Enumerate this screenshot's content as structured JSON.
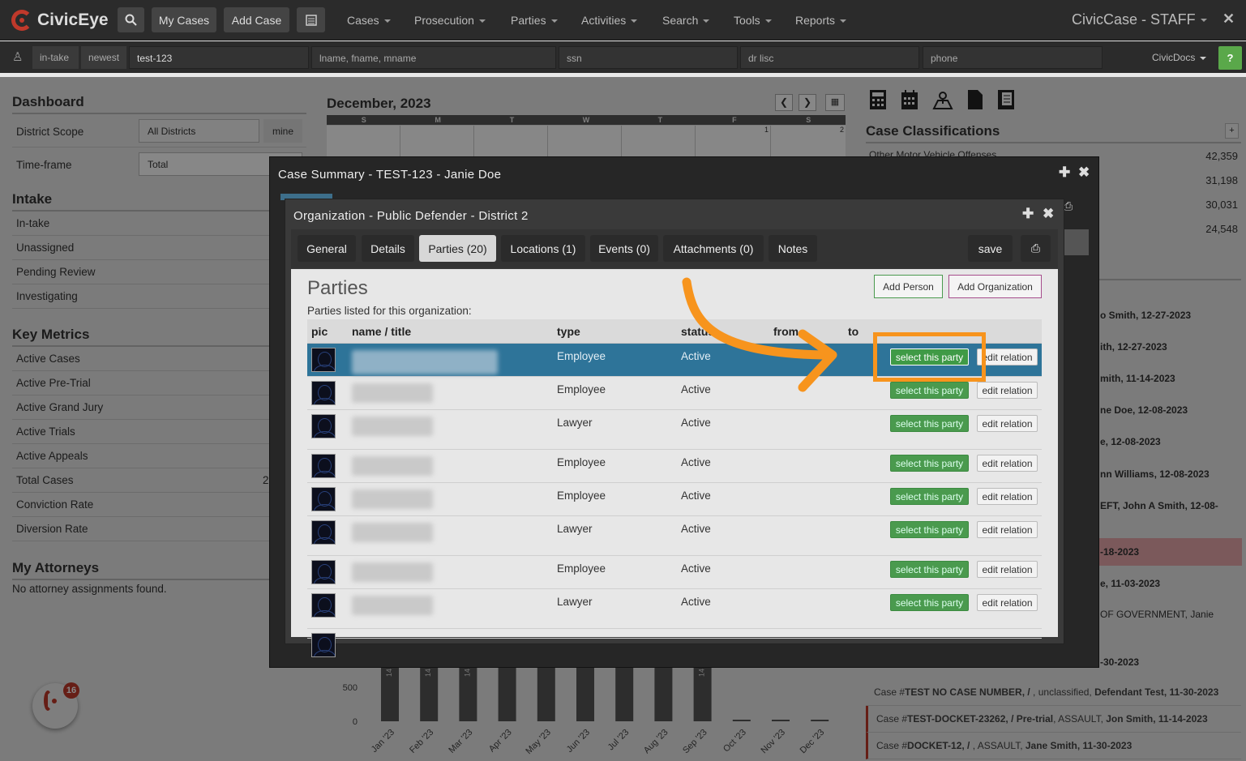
{
  "brand": "CivicEye",
  "topnav": {
    "my_cases": "My Cases",
    "add_case": "Add Case",
    "menus": [
      "Cases",
      "Prosecution",
      "Parties",
      "Activities",
      "Search",
      "Tools",
      "Reports"
    ],
    "app_title": "CivicCase - STAFF"
  },
  "searchbar": {
    "intake": "in-take",
    "newest": "newest",
    "case_value": "test-123",
    "name_placeholder": "lname, fname, mname",
    "ssn_placeholder": "ssn",
    "dl_placeholder": "dr lisc",
    "phone_placeholder": "phone",
    "docs": "CivicDocs",
    "help": "?"
  },
  "dashboard": {
    "title": "Dashboard",
    "district_label": "District Scope",
    "district_value": "All Districts",
    "mine": "mine",
    "timeframe_label": "Time-frame",
    "timeframe_value": "Total",
    "intake_title": "Intake",
    "intake_items": [
      "In-take",
      "Unassigned",
      "Pending Review",
      "Investigating"
    ],
    "metrics_title": "Key Metrics",
    "metrics_items": [
      "Active Cases",
      "Active Pre-Trial",
      "Active Grand Jury",
      "Active Trials",
      "Active Appeals",
      "Total Cases",
      "Conviction Rate",
      "Diversion Rate"
    ],
    "total_cases_partial": "2",
    "attorneys_title": "My Attorneys",
    "attorneys_empty": "No attorney assignments found."
  },
  "calendar": {
    "title": "December, 2023",
    "days": [
      "S",
      "M",
      "T",
      "W",
      "T",
      "F",
      "S"
    ],
    "date_1": "1",
    "date_2": "2"
  },
  "chart_data": {
    "type": "bar",
    "categories": [
      "Jan '23",
      "Feb '23",
      "Mar '23",
      "Apr '23",
      "May '23",
      "Jun '23",
      "Jul '23",
      "Aug '23",
      "Sep '23",
      "Oct '23",
      "Nov '23",
      "Dec '23"
    ],
    "yticks": [
      "500",
      "0"
    ],
    "bar_labels": [
      "14",
      "14",
      "14",
      "",
      "",
      "",
      "",
      "",
      "14",
      "",
      "",
      ""
    ]
  },
  "classifications": {
    "title": "Case Classifications",
    "first_item": "Other Motor Vehicle Offenses",
    "counts": [
      "42,359",
      "31,198",
      "30,031",
      "24,548"
    ],
    "plus": "+"
  },
  "recent": {
    "items": [
      "o Smith, 12-27-2023",
      "ith, 12-27-2023",
      "mith, 11-14-2023",
      "ne Doe, 12-08-2023",
      "e, 12-08-2023",
      "nn Williams, 12-08-2023",
      "EFT, John A Smith, 12-08-",
      "-18-2023",
      "e, 11-03-2023",
      "OF GOVERNMENT, Janie",
      "-30-2023"
    ],
    "case_lines": [
      {
        "prefix": "Case #",
        "num": "TEST NO CASE NUMBER, / ",
        "mid": ", unclassified, ",
        "party": "Defendant Test, 11-30-2023"
      },
      {
        "prefix": "Case #",
        "num": "TEST-DOCKET-23262, / Pre-trial",
        "mid": ", ASSAULT, ",
        "party": "Jon Smith, 11-14-2023"
      },
      {
        "prefix": "Case #",
        "num": "DOCKET-12, / ",
        "mid": ", ASSAULT, ",
        "party": "Jane Smith, 11-30-2023"
      }
    ]
  },
  "notif_count": "16",
  "case_dialog": {
    "title": "Case Summary - TEST-123 - Janie Doe"
  },
  "org_dialog": {
    "title": "Organization - Public Defender - District 2",
    "tabs": [
      "General",
      "Details",
      "Parties (20)",
      "Locations (1)",
      "Events (0)",
      "Attachments (0)",
      "Notes"
    ],
    "save": "save",
    "parties_heading": "Parties",
    "subtitle": "Parties listed for this organization:",
    "add_person": "Add Person",
    "add_org": "Add Organization",
    "columns": {
      "pic": "pic",
      "name": "name / title",
      "type": "type",
      "status": "status",
      "from": "from",
      "to": "to"
    },
    "select_label": "select this party",
    "relation_label": "edit relation",
    "rows": [
      {
        "type": "Employee",
        "status": "Active"
      },
      {
        "type": "Employee",
        "status": "Active"
      },
      {
        "type": "Lawyer",
        "status": "Active"
      },
      {
        "type": "Employee",
        "status": "Active"
      },
      {
        "type": "Employee",
        "status": "Active"
      },
      {
        "type": "Lawyer",
        "status": "Active"
      },
      {
        "type": "Employee",
        "status": "Active"
      },
      {
        "type": "Lawyer",
        "status": "Active"
      }
    ]
  },
  "colors": {
    "accent_green": "#4a9a4e",
    "highlight_orange": "#f7941d",
    "selected_row": "#2e7499"
  }
}
